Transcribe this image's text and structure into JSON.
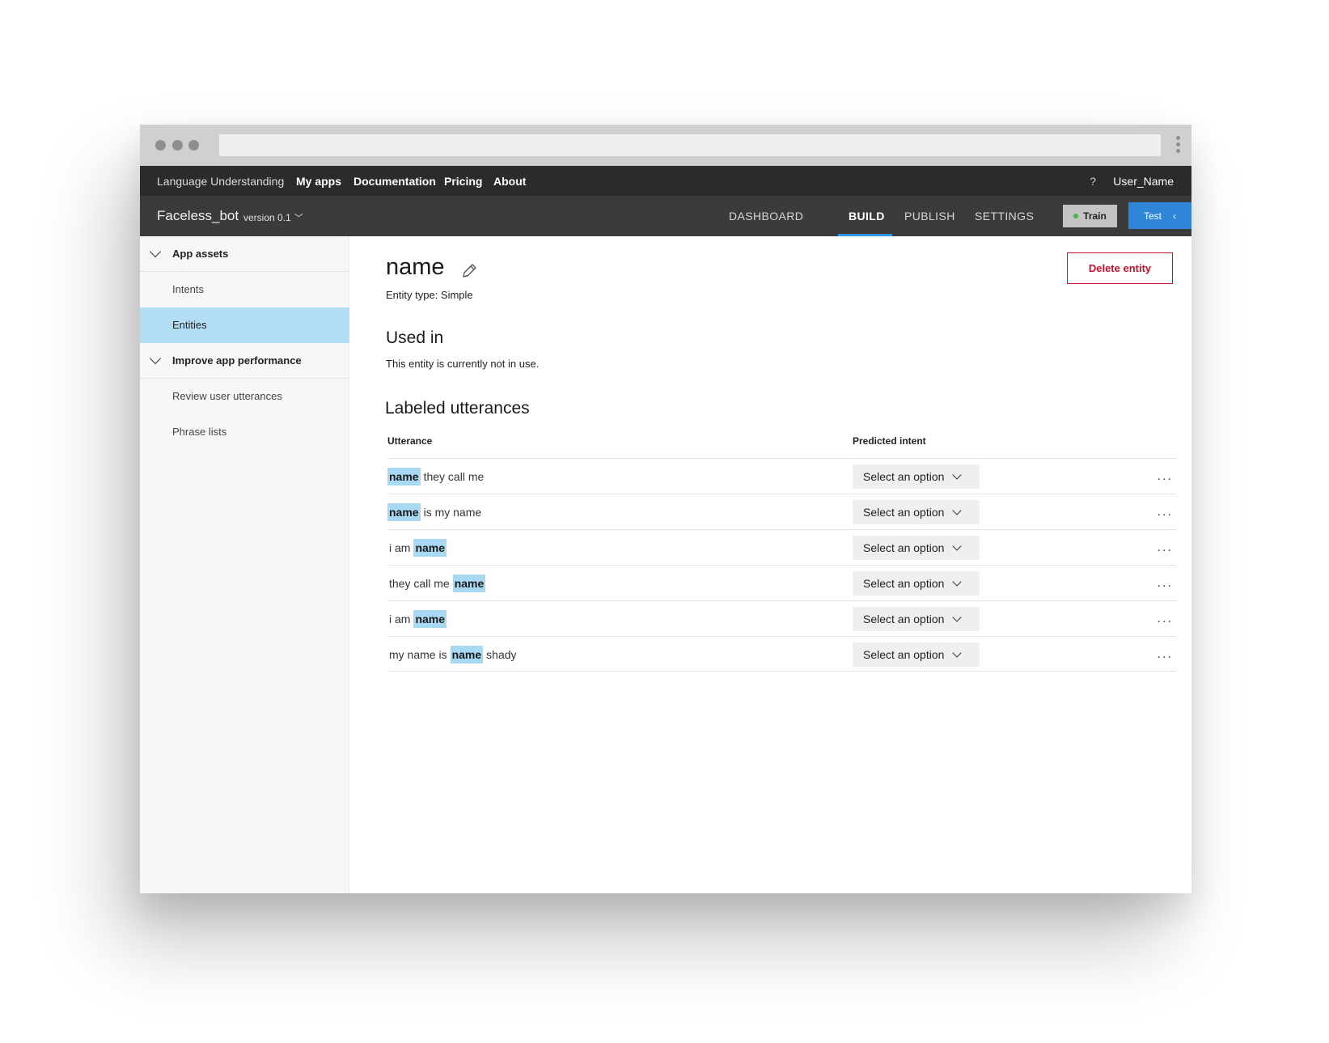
{
  "topnav": {
    "brand": "Language Understanding",
    "links": [
      "My apps",
      "Documentation",
      "Pricing",
      "About"
    ],
    "help": "?",
    "user": "User_Name"
  },
  "appbar": {
    "app_name": "Faceless_bot",
    "version": "version 0.1",
    "tabs": [
      "DASHBOARD",
      "BUILD",
      "PUBLISH",
      "SETTINGS"
    ],
    "active_tab": "BUILD",
    "train_label": "Train",
    "test_label": "Test"
  },
  "sidebar": {
    "group1": "App assets",
    "group1_items": [
      "Intents",
      "Entities"
    ],
    "group2": "Improve app performance",
    "group2_items": [
      "Review user utterances",
      "Phrase lists"
    ],
    "selected": "Entities"
  },
  "entity": {
    "title": "name",
    "type_label": "Entity type: Simple",
    "delete_label": "Delete entity"
  },
  "used_in": {
    "heading": "Used in",
    "text": "This entity is currently not in use."
  },
  "labeled": {
    "heading": "Labeled utterances",
    "col_utterance": "Utterance",
    "col_intent": "Predicted intent",
    "select_placeholder": "Select an option",
    "more_label": "...",
    "rows": [
      {
        "tokens": [
          {
            "t": "name",
            "e": true
          },
          {
            "t": "they call me",
            "e": false
          }
        ]
      },
      {
        "tokens": [
          {
            "t": "name",
            "e": true
          },
          {
            "t": "is my name",
            "e": false
          }
        ]
      },
      {
        "tokens": [
          {
            "t": "i am",
            "e": false
          },
          {
            "t": "name",
            "e": true
          }
        ]
      },
      {
        "tokens": [
          {
            "t": "they call me",
            "e": false
          },
          {
            "t": "name",
            "e": true
          }
        ]
      },
      {
        "tokens": [
          {
            "t": "i am",
            "e": false
          },
          {
            "t": "name",
            "e": true
          }
        ]
      },
      {
        "tokens": [
          {
            "t": "my name is",
            "e": false
          },
          {
            "t": "name",
            "e": true
          },
          {
            "t": "shady",
            "e": false
          }
        ]
      }
    ]
  },
  "colors": {
    "accent": "#2f86d9",
    "selection": "#b3dcf5",
    "entity_highlight": "#a9d8f3",
    "danger": "#c8102e",
    "nav_dark": "#2b2b2b",
    "appbar": "#3b3b3b"
  }
}
